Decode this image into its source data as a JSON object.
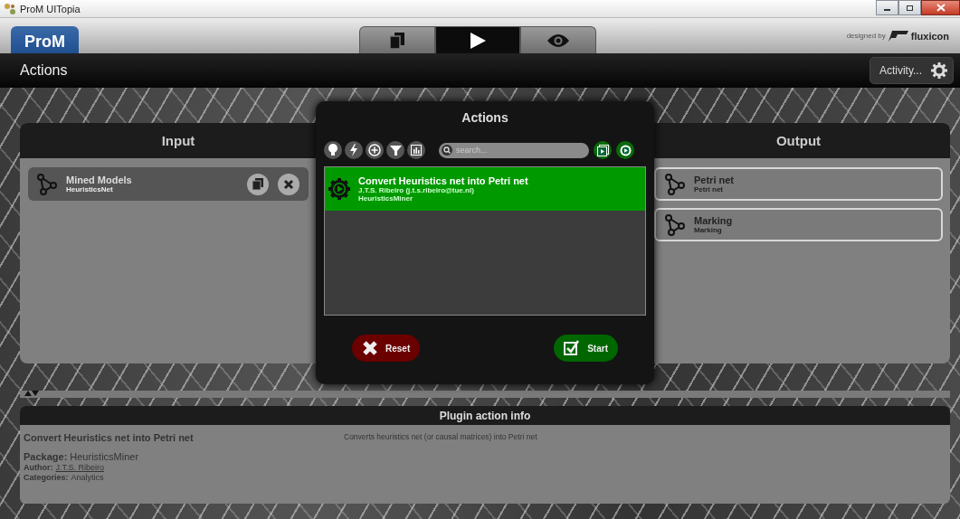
{
  "window": {
    "title": "ProM UITopia"
  },
  "header": {
    "logo": "ProM",
    "tabs": [
      {
        "kind": "workspace",
        "selected": false
      },
      {
        "kind": "actions",
        "selected": true
      },
      {
        "kind": "view",
        "selected": false
      }
    ],
    "credit": "designed by",
    "brand": "fluxicon"
  },
  "toolbar": {
    "title": "Actions",
    "activity_button": "Activity..."
  },
  "input": {
    "title": "Input",
    "items": [
      {
        "name": "Mined Models",
        "type": "HeuristicsNet"
      }
    ]
  },
  "output": {
    "title": "Output",
    "items": [
      {
        "name": "Petri net",
        "type": "Petri net"
      },
      {
        "name": "Marking",
        "type": "Marking"
      }
    ]
  },
  "actions_dialog": {
    "title": "Actions",
    "filters": [
      {
        "kind": "bulb"
      },
      {
        "kind": "bolt"
      },
      {
        "kind": "plus"
      },
      {
        "kind": "funnel"
      },
      {
        "kind": "chart"
      }
    ],
    "search": {
      "placeholder": "search..."
    },
    "toggles": [
      {
        "kind": "visualizers",
        "on": true
      },
      {
        "kind": "plugins",
        "on": true
      }
    ],
    "plugins": [
      {
        "name": "Convert Heuristics net into Petri net",
        "author": "J.T.S. Ribeiro (j.t.s.ribeiro@tue.nl)",
        "package": "HeuristicsMiner",
        "selected": true
      }
    ],
    "reset": "Reset",
    "start": "Start"
  },
  "info": {
    "title": "Plugin action info",
    "name": "Convert Heuristics net into Petri net",
    "description": "Converts heuristics net (or causal matrices) into Petri net",
    "package_label": "Package:",
    "package": "HeuristicsMiner",
    "author_label": "Author:",
    "author": "J.T.S. Ribeiro",
    "categories_label": "Categories:",
    "categories": "Analytics"
  }
}
